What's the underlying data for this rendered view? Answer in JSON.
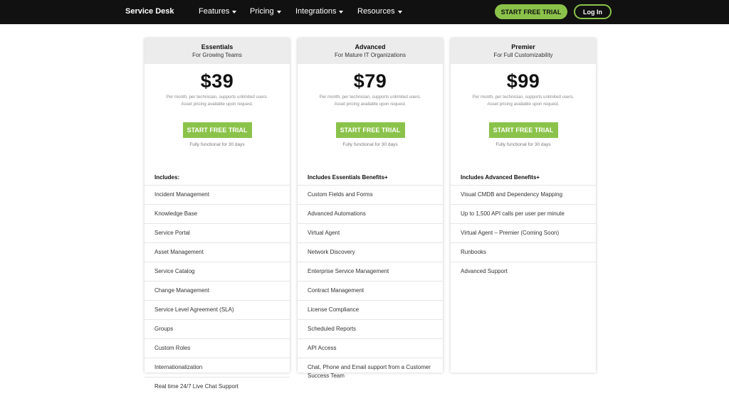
{
  "nav": {
    "brand": "Service Desk",
    "items": [
      {
        "label": "Features"
      },
      {
        "label": "Pricing"
      },
      {
        "label": "Integrations"
      },
      {
        "label": "Resources"
      }
    ],
    "trial_label": "START FREE TRIAL",
    "login_label": "Log In"
  },
  "colors": {
    "accent": "#8bc34a",
    "nav_bg": "#111111",
    "header_bg": "#ececec"
  },
  "plans": [
    {
      "name": "Essentials",
      "subtitle": "For Growing Teams",
      "price": "$39",
      "desc_line1": "Per month, per technician, supports unlimited users.",
      "desc_line2": "Asset pricing available upon request.",
      "trial_label": "START FREE TRIAL",
      "trial_note": "Fully functional for 30 days",
      "includes_title": "Includes:",
      "features": [
        "Incident Management",
        "Knowledge Base",
        "Service Portal",
        "Asset Management",
        "Service Catalog",
        "Change Management",
        "Service Level Agreement (SLA)",
        "Groups",
        "Custom Roles",
        "Internationalization",
        "Real time 24/7 Live Chat Support"
      ]
    },
    {
      "name": "Advanced",
      "subtitle": "For Mature IT Organizations",
      "price": "$79",
      "desc_line1": "Per month, per technician, supports unlimited users.",
      "desc_line2": "Asset pricing available upon request.",
      "trial_label": "START FREE TRIAL",
      "trial_note": "Fully functional for 30 days",
      "includes_title": "Includes Essentials Benefits+",
      "features": [
        "Custom Fields and Forms",
        "Advanced Automations",
        "Virtual Agent",
        "Network Discovery",
        "Enterprise Service Management",
        "Contract Management",
        "License Compliance",
        "Scheduled Reports",
        "API Access",
        "Chat, Phone and Email support from a Customer Success Team"
      ]
    },
    {
      "name": "Premier",
      "subtitle": "For Full Customizability",
      "price": "$99",
      "desc_line1": "Per month, per technician, supports unlimited users.",
      "desc_line2": "Asset pricing available upon request.",
      "trial_label": "START FREE TRIAL",
      "trial_note": "Fully functional for 30 days",
      "includes_title": "Includes Advanced Benefits+",
      "features": [
        "Visual CMDB and Dependency Mapping",
        "Up to 1,500 API calls per user per minute",
        "Virtual Agent – Premier (Coming Soon)",
        "Runbooks",
        "Advanced Support"
      ]
    }
  ]
}
